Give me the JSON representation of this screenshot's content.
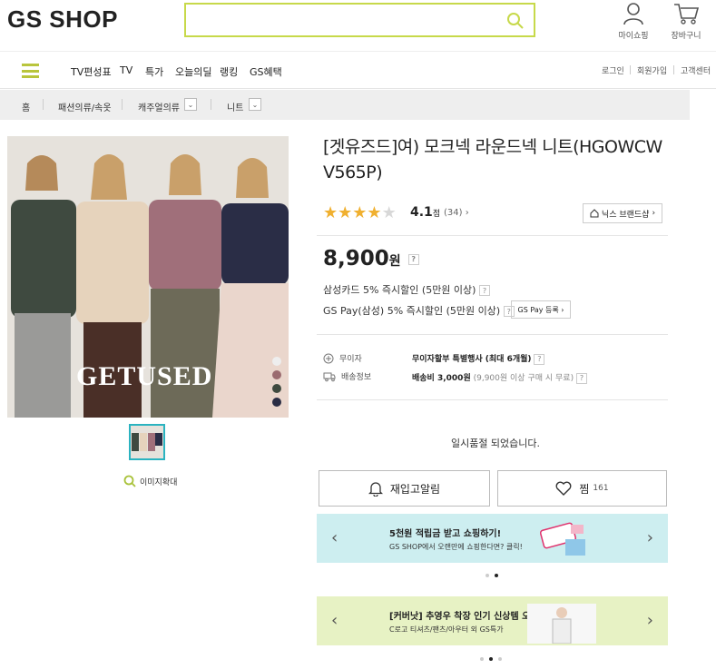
{
  "header": {
    "logo": "GS SHOP",
    "search": {
      "placeholder": "",
      "value": ""
    },
    "my_label": "마이쇼핑",
    "cart_label": "장바구니"
  },
  "nav": {
    "items": [
      "TV편성표",
      "TV",
      "특가",
      "오늘의딜",
      "랭킹",
      "GS혜택"
    ],
    "util": [
      "로그인",
      "회원가입",
      "고객센터"
    ]
  },
  "breadcrumb": {
    "home": "홈",
    "level1": "패션의류/속옷",
    "level2": "캐주얼의류",
    "level3": "니트"
  },
  "product": {
    "image_text": "GETUSED",
    "swatch_colors": [
      "#eeeeee",
      "#9b6b6f",
      "#3f4a3f",
      "#2a2d44"
    ],
    "zoom_label": "이미지확대",
    "title_line1": "[겟유즈드]여) 모크넥 라운드넥 니트(HGOWCW",
    "title_line2": "V565P)",
    "rating_stars": 4,
    "rating_max": 5,
    "rating_value": "4.1",
    "rating_unit": "점",
    "review_count": "(34)",
    "brand_button": "닉스 브랜드샵",
    "price": "8,900",
    "price_unit": "원",
    "discount1": "삼성카드 5% 즉시할인 (5만원 이상)",
    "discount2": "GS Pay(삼성) 5% 즉시할인 (5만원 이상)",
    "gspay_button": "GS Pay 등록",
    "installment_label": "무이자",
    "installment_value": "무이자할부 특별행사 (최대 6개월)",
    "shipping_label": "배송정보",
    "shipping_value": "배송비 3,000원",
    "shipping_note": "(9,900원 이상 구매 시 무료)",
    "soldout": "일시품절 되었습니다.",
    "restock_button": "재입고알림",
    "wish_button": "찜",
    "wish_count": "161"
  },
  "banners": [
    {
      "title": "5천원 적립금 받고 쇼핑하기!",
      "sub": "GS SHOP에서 오랜만에 쇼핑한다면? 클릭!",
      "bg": "#cdeef0"
    },
    {
      "title": "[커버낫] 추영우 착장 인기 신상템 오픈",
      "sub": "C로고 티셔츠/팬츠/아우터 외 GS특가",
      "bg": "#e7f2c4"
    }
  ],
  "colors": {
    "accent": "#c7d94a",
    "logo_o": "#e0306c",
    "star": "#f0b030",
    "thumb_border": "#2bb3c0"
  }
}
